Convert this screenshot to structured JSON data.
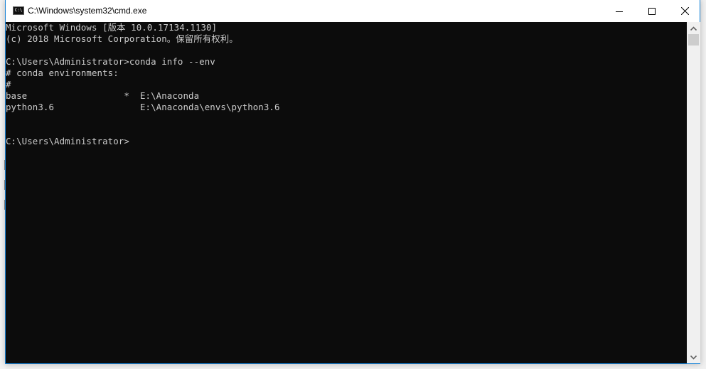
{
  "window": {
    "title": "C:\\Windows\\system32\\cmd.exe",
    "icon": "cmd-icon",
    "icon_text": "C:\\",
    "controls": {
      "minimize": "minimize-icon",
      "maximize": "maximize-icon",
      "close": "close-icon"
    }
  },
  "console": {
    "lines": [
      "Microsoft Windows [版本 10.0.17134.1130]",
      "(c) 2018 Microsoft Corporation。保留所有权利。",
      "",
      "C:\\Users\\Administrator>conda info --env",
      "# conda environments:",
      "#",
      "base                  *  E:\\Anaconda",
      "python3.6                E:\\Anaconda\\envs\\python3.6",
      "",
      "",
      "C:\\Users\\Administrator>"
    ],
    "colors": {
      "background": "#0c0c0c",
      "foreground": "#cccccc"
    }
  },
  "scrollbar": {
    "up": "scroll-up-icon",
    "down": "scroll-down-icon"
  },
  "accent": "#1883d7"
}
